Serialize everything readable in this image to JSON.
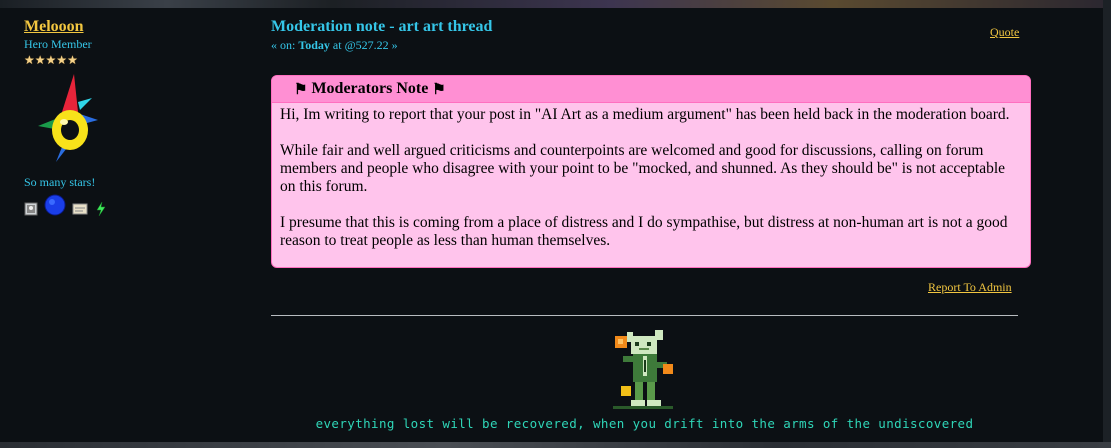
{
  "poster": {
    "name": "Melooon",
    "rank": "Hero Member",
    "star_count": 5,
    "personal_text": "So many stars!",
    "icons": [
      "profile-icon",
      "blue-orb-icon",
      "message-icon",
      "online-status-icon"
    ]
  },
  "post": {
    "subject": "Moderation note - art art thread",
    "meta_prefix": "« on:",
    "meta_date": "Today",
    "meta_time": "at @527.22 »",
    "quote_label": "Quote"
  },
  "moderator_note": {
    "title": "Moderators Note",
    "paragraphs": [
      "Hi, Im writing to report that your post in \"AI Art as a medium argument\" has been held back in the moderation board.",
      "While fair and well argued criticisms and counterpoints are welcomed and good for discussions, calling on forum members and people who disagree with your point to be \"mocked, and shunned. As they should be\" is not acceptable on this forum.",
      "I presume that this is coming from a place of distress and I do sympathise, but distress at non-human art is not a good reason to treat people as less than human themselves."
    ]
  },
  "report_label": "Report To Admin",
  "signature": {
    "text": "everything lost will be recovered, when you drift into the arms of the undiscovered"
  },
  "colors": {
    "background": "#0c1014",
    "name": "#f2c640",
    "accent": "#35c6e8",
    "note_header": "#ff8fd3",
    "note_body": "#ffc4ec",
    "signature": "#2fd6b8"
  }
}
